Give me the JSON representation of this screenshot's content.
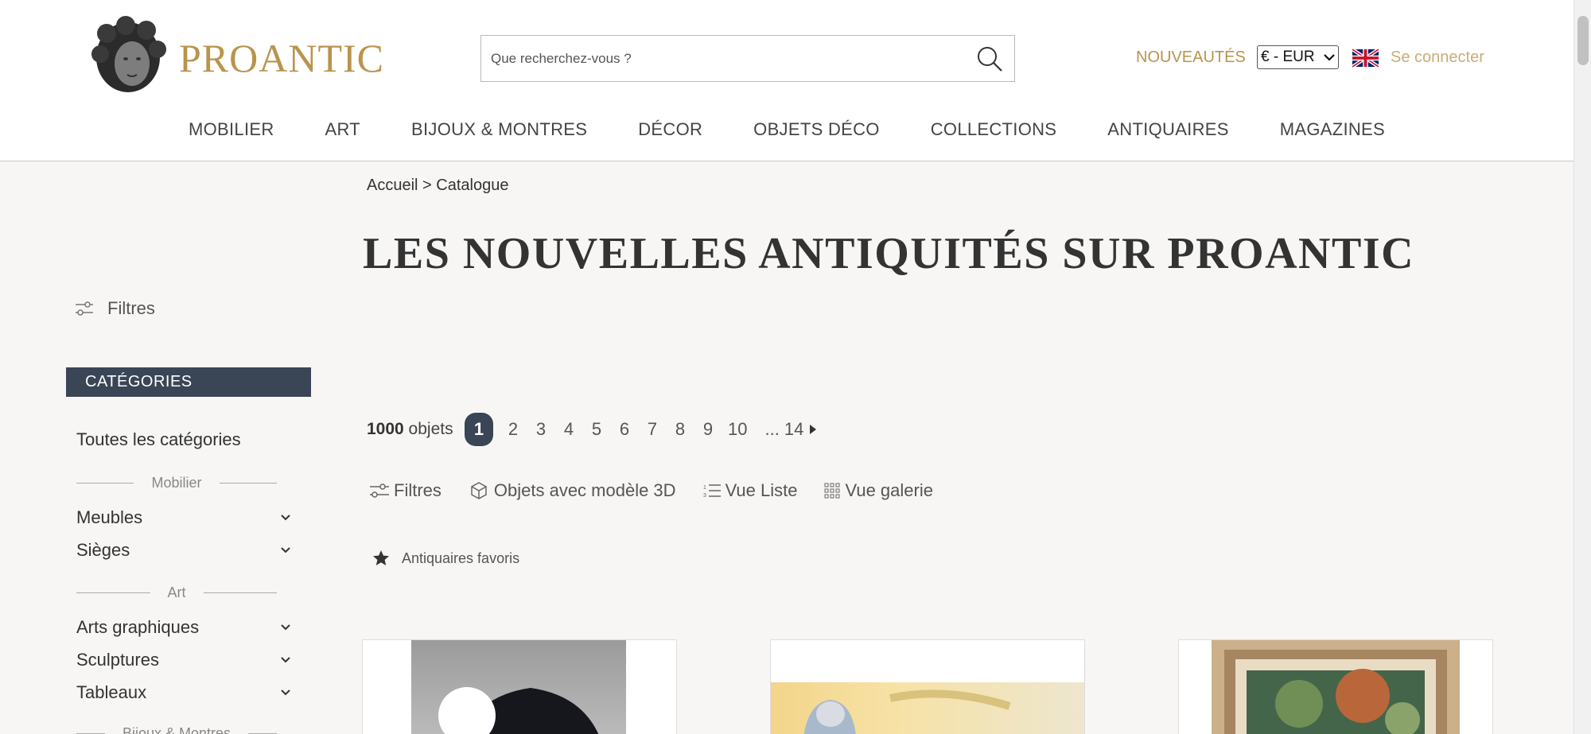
{
  "header": {
    "brand": "PROANTIC",
    "search_placeholder": "Que recherchez-vous ?",
    "nouveautes": "NOUVEAUTÉS",
    "currency": "€ - EUR",
    "login": "Se connecter",
    "nav": [
      "MOBILIER",
      "ART",
      "BIJOUX & MONTRES",
      "DÉCOR",
      "OBJETS DÉCO",
      "COLLECTIONS",
      "ANTIQUAIRES",
      "MAGAZINES"
    ]
  },
  "breadcrumb": {
    "home": "Accueil",
    "separator": " > ",
    "current": "Catalogue"
  },
  "page_title": "LES NOUVELLES ANTIQUITÉS SUR PROANTIC",
  "sidebar": {
    "filters": "Filtres",
    "categories_title": "CATÉGORIES",
    "all_categories": "Toutes les catégories",
    "groups": [
      {
        "label": "Mobilier",
        "items": [
          "Meubles",
          "Sièges"
        ]
      },
      {
        "label": "Art",
        "items": [
          "Arts graphiques",
          "Sculptures",
          "Tableaux"
        ]
      },
      {
        "label": "Bijoux & Montres",
        "items": []
      }
    ]
  },
  "results": {
    "count": "1000",
    "count_suffix": " objets",
    "pages": [
      "1",
      "2",
      "3",
      "4",
      "5",
      "6",
      "7",
      "8",
      "9",
      "10"
    ],
    "active_page": "1",
    "last_page_label": "... 14"
  },
  "toolbar": {
    "filters": "Filtres",
    "objects_3d": "Objets avec modèle 3D",
    "list_view": "Vue Liste",
    "gallery_view": "Vue galerie"
  },
  "favorites": "Antiquaires favoris",
  "colors": {
    "gold": "#b8944d",
    "navy": "#3a4556",
    "background": "#f7f6f4"
  }
}
